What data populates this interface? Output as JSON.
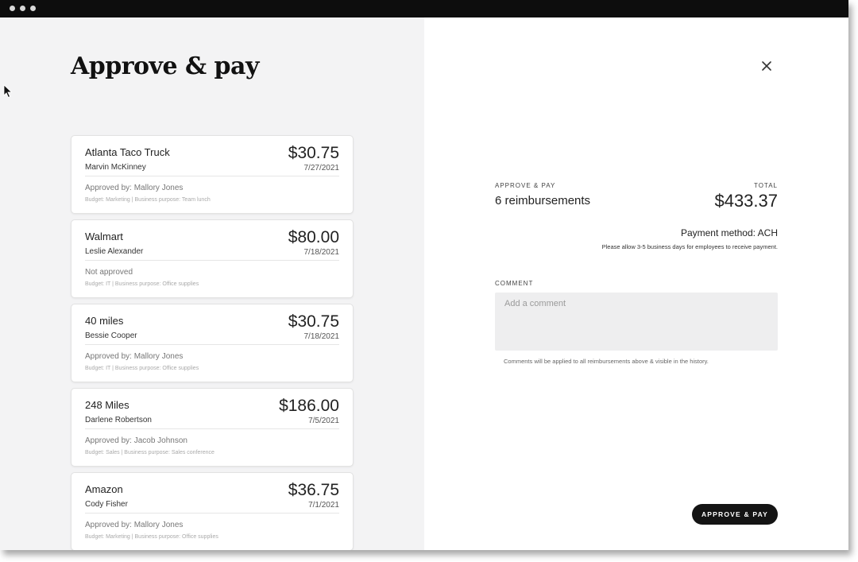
{
  "page": {
    "title": "Approve & pay"
  },
  "reimbursements": [
    {
      "merchant": "Atlanta Taco Truck",
      "employee": "Marvin McKinney",
      "amount": "$30.75",
      "date": "7/27/2021",
      "approval": "Approved by: Mallory Jones",
      "budget": "Budget: Marketing | Business purpose: Team lunch"
    },
    {
      "merchant": "Walmart",
      "employee": "Leslie Alexander",
      "amount": "$80.00",
      "date": "7/18/2021",
      "approval": "Not approved",
      "budget": "Budget: IT | Business purpose: Office supplies"
    },
    {
      "merchant": "40 miles",
      "employee": "Bessie Cooper",
      "amount": "$30.75",
      "date": "7/18/2021",
      "approval": "Approved by: Mallory Jones",
      "budget": "Budget: IT | Business purpose: Office supplies"
    },
    {
      "merchant": "248 Miles",
      "employee": "Darlene Robertson",
      "amount": "$186.00",
      "date": "7/5/2021",
      "approval": "Approved by: Jacob Johnson",
      "budget": "Budget: Sales | Business purpose: Sales conference"
    },
    {
      "merchant": "Amazon",
      "employee": "Cody Fisher",
      "amount": "$36.75",
      "date": "7/1/2021",
      "approval": "Approved by: Mallory Jones",
      "budget": "Budget: Marketing | Business purpose: Office supplies"
    }
  ],
  "summary": {
    "label": "APPROVE & PAY",
    "count": "6 reimbursements",
    "total_label": "TOTAL",
    "total_amount": "$433.37",
    "payment_method": "Payment method: ACH",
    "payment_note": "Please allow 3-5 business days for employees to receive payment."
  },
  "comment": {
    "label": "COMMENT",
    "placeholder": "Add a comment",
    "value": "",
    "help": "Comments will be applied to all reimbursements above & visible in the history."
  },
  "actions": {
    "approve_label": "APPROVE & PAY"
  },
  "icons": {
    "close": "close-icon",
    "cursor": "cursor-pointer-icon",
    "window_dots": "window-dots-icon"
  },
  "colors": {
    "left_panel_bg": "#f3f3f4",
    "button_bg": "#141414",
    "titlebar_bg": "#0d0d0d"
  }
}
